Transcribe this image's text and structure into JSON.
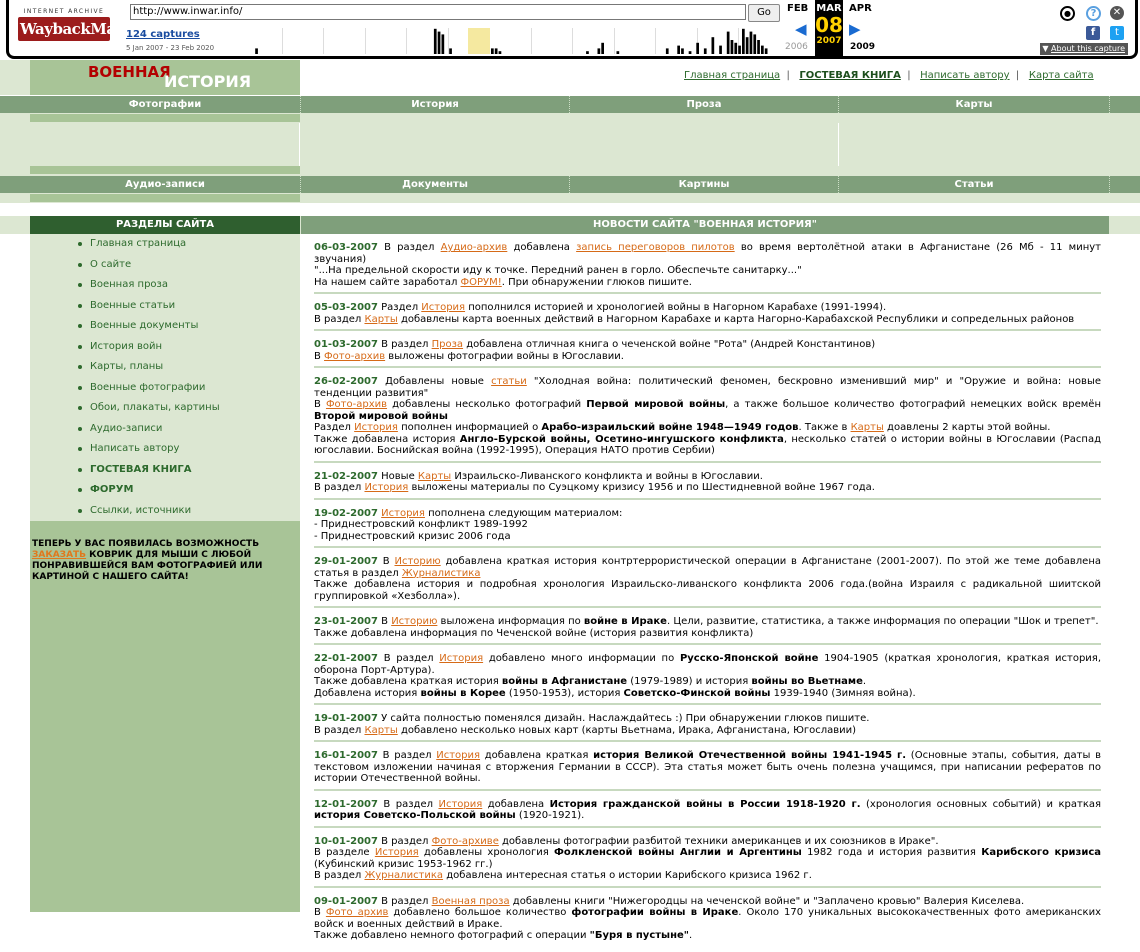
{
  "wayback": {
    "logo_top": "INTERNET ARCHIVE",
    "logo_main": "WaybackMachine",
    "url": "http://www.inwar.info/",
    "go_label": "Go",
    "captures": "124 captures",
    "date_range": "5 Jan 2007 - 23 Feb 2020",
    "month_prev": "FEB",
    "month_cur": "MAR",
    "month_next": "APR",
    "day": "08",
    "year_prev": "2006",
    "year_cur": "2007",
    "year_next": "2009",
    "about": "About this capture",
    "sparkline_values": [
      0,
      0,
      0,
      0,
      2,
      0,
      0,
      0,
      0,
      0,
      0,
      0,
      0,
      0,
      0,
      0,
      0,
      0,
      0,
      0,
      0,
      0,
      0,
      0,
      0,
      0,
      0,
      0,
      0,
      0,
      0,
      0,
      0,
      0,
      0,
      0,
      0,
      0,
      0,
      0,
      0,
      0,
      0,
      0,
      0,
      0,
      0,
      0,
      0,
      0,
      0,
      9,
      8,
      7,
      0,
      2,
      0,
      0,
      0,
      0,
      0,
      0,
      0,
      0,
      0,
      0,
      2,
      2,
      1,
      0,
      0,
      0,
      0,
      0,
      0,
      0,
      0,
      0,
      0,
      0,
      0,
      0,
      0,
      0,
      0,
      0,
      0,
      0,
      0,
      0,
      0,
      1,
      0,
      0,
      2,
      4,
      0,
      0,
      0,
      1,
      0,
      0,
      0,
      0,
      0,
      0,
      0,
      0,
      0,
      0,
      0,
      0,
      2,
      0,
      0,
      3,
      2,
      0,
      1,
      0,
      4,
      0,
      2,
      0,
      6,
      0,
      3,
      0,
      8,
      5,
      4,
      3,
      9,
      6,
      8,
      7,
      5,
      3,
      2,
      0,
      0,
      0
    ]
  },
  "site": {
    "logo_word1": "ВОЕННАЯ",
    "logo_word2": "ИСТОРИЯ",
    "toplinks": [
      "Главная страница",
      "ГОСТЕВАЯ КНИГА",
      "Написать автору",
      "Карта сайта"
    ],
    "menu1": [
      "Фотографии",
      "История",
      "Проза",
      "Карты"
    ],
    "menu2": [
      "Аудио-записи",
      "Документы",
      "Картины",
      "Статьи"
    ],
    "sidebar_title": "РАЗДЕЛЫ САЙТА",
    "news_title": "НОВОСТИ САЙТА \"ВОЕННАЯ ИСТОРИЯ\"",
    "sidebar": [
      {
        "label": "Главная страница",
        "bold": false
      },
      {
        "label": "О сайте",
        "bold": false
      },
      {
        "label": "Военная проза",
        "bold": false
      },
      {
        "label": "Военные статьи",
        "bold": false
      },
      {
        "label": "Военные документы",
        "bold": false
      },
      {
        "label": "История войн",
        "bold": false
      },
      {
        "label": "Карты, планы",
        "bold": false
      },
      {
        "label": "Военные фотографии",
        "bold": false
      },
      {
        "label": "Обои, плакаты, картины",
        "bold": false
      },
      {
        "label": "Аудио-записи",
        "bold": false
      },
      {
        "label": "Написать автору",
        "bold": false
      },
      {
        "label": "ГОСТЕВАЯ КНИГА",
        "bold": true
      },
      {
        "label": "ФОРУМ",
        "bold": true
      },
      {
        "label": "Ссылки, источники",
        "bold": false
      }
    ],
    "promo": {
      "part1": "ТЕПЕРЬ У ВАС ПОЯВИЛАСЬ ВОЗМОЖНОСТЬ ",
      "link": "ЗАКАЗАТЬ",
      "part2": " КОВРИК ДЛЯ МЫШИ С ЛЮБОЙ ПОНРАВИВШЕЙСЯ ВАМ ФОТОГРАФИЕЙ ИЛИ КАРТИНОЙ С НАШЕГО САЙТА!"
    }
  },
  "news": [
    {
      "date": "06-03-2007",
      "lines": [
        [
          [
            "t",
            " В раздел "
          ],
          [
            "l",
            "Аудио-архив"
          ],
          [
            "t",
            " добавлена "
          ],
          [
            "l",
            "запись переговоров пилотов"
          ],
          [
            "t",
            " во время вертолётной атаки в Афганистане (26 Мб - 11 минут звучания)"
          ]
        ],
        [
          [
            "t",
            "\"...На предельной скорости иду к точке. Передний ранен в горло. Обеспечьте санитарку...\""
          ]
        ],
        [
          [
            "t",
            "На нашем сайте заработал "
          ],
          [
            "l",
            "ФОРУМ!"
          ],
          [
            "t",
            ". При обнаружении глюков пишите."
          ]
        ]
      ]
    },
    {
      "date": "05-03-2007",
      "lines": [
        [
          [
            "t",
            " Раздел "
          ],
          [
            "l",
            "История"
          ],
          [
            "t",
            " пополнился историей и хронологией войны в Нагорном Карабахе (1991-1994)."
          ]
        ],
        [
          [
            "t",
            "В раздел "
          ],
          [
            "l",
            "Карты"
          ],
          [
            "t",
            " добавлены карта военных действий в Нагорном Карабахе и карта Нагорно-Карабахской Республики и сопредельных районов"
          ]
        ]
      ]
    },
    {
      "date": "01-03-2007",
      "lines": [
        [
          [
            "t",
            " В раздел "
          ],
          [
            "l",
            "Проза"
          ],
          [
            "t",
            " добавлена отличная книга о чеченской войне \"Рота\" (Андрей Константинов)"
          ]
        ],
        [
          [
            "t",
            "В "
          ],
          [
            "l",
            "Фото-архив"
          ],
          [
            "t",
            " выложены фотографии войны в Югославии."
          ]
        ]
      ]
    },
    {
      "date": "26-02-2007",
      "lines": [
        [
          [
            "t",
            " Добавлены новые "
          ],
          [
            "l",
            "статьи"
          ],
          [
            "t",
            " \"Холодная война: политический феномен, бескровно изменивший мир\" и \"Оружие и война: новые тенденции развития\""
          ]
        ],
        [
          [
            "t",
            "В "
          ],
          [
            "l",
            "Фото-архив"
          ],
          [
            "t",
            " добавлены несколько фотографий "
          ],
          [
            "b",
            "Первой мировой войны"
          ],
          [
            "t",
            ", а также большое количество фотографий немецких войск времён "
          ],
          [
            "b",
            "Второй мировой войны"
          ]
        ],
        [
          [
            "t",
            "Раздел "
          ],
          [
            "l",
            "История"
          ],
          [
            "t",
            " пополнен информацией о "
          ],
          [
            "b",
            "Арабо-израильский войне 1948—1949 годов"
          ],
          [
            "t",
            ". Также в "
          ],
          [
            "l",
            "Карты"
          ],
          [
            "t",
            " доавлены 2 карты этой войны."
          ]
        ],
        [
          [
            "t",
            "Также добавлена история "
          ],
          [
            "b",
            "Англо-Бурской войны, Осетино-ингушского конфликта"
          ],
          [
            "t",
            ", несколько статей о истории войны в Югославии (Распад югославии. Боснийская война (1992-1995), Операция НАТО против Сербии)"
          ]
        ]
      ]
    },
    {
      "date": "21-02-2007",
      "lines": [
        [
          [
            "t",
            " Новые "
          ],
          [
            "l",
            "Карты"
          ],
          [
            "t",
            " Израильско-Ливанского конфликта и войны в Югославии."
          ]
        ],
        [
          [
            "t",
            "В раздел "
          ],
          [
            "l",
            "История"
          ],
          [
            "t",
            " выложены материалы по Суэцкому кризису 1956 и по Шестидневной войне 1967 года."
          ]
        ]
      ]
    },
    {
      "date": "19-02-2007",
      "lines": [
        [
          [
            "t",
            " "
          ],
          [
            "l",
            "История"
          ],
          [
            "t",
            " пополнена следующим материалом:"
          ]
        ],
        [
          [
            "t",
            "- Приднестровский конфликт 1989-1992"
          ]
        ],
        [
          [
            "t",
            "- Приднестровский кризис 2006 года"
          ]
        ]
      ]
    },
    {
      "date": "29-01-2007",
      "lines": [
        [
          [
            "t",
            " В "
          ],
          [
            "l",
            "Историю"
          ],
          [
            "t",
            " добавлена краткая история контртеррористической операции в Афганистане (2001-2007). По этой же теме добавлена статья в раздел "
          ],
          [
            "l",
            "Журналистика"
          ]
        ],
        [
          [
            "t",
            "Также добавлена история и подробная хронология Израильско-ливанского конфликта 2006 года.(война Израиля с радикальной шиитской группировкой «Хезболла»)."
          ]
        ]
      ]
    },
    {
      "date": "23-01-2007",
      "lines": [
        [
          [
            "t",
            " В "
          ],
          [
            "l",
            "Историю"
          ],
          [
            "t",
            " выложена информация по "
          ],
          [
            "b",
            "войне в Ираке"
          ],
          [
            "t",
            ". Цели, развитие, статистика, а также информация по операции \"Шок и трепет\"."
          ]
        ],
        [
          [
            "t",
            "Также добавлена информация по Чеченской войне (история развития конфликта)"
          ]
        ]
      ]
    },
    {
      "date": "22-01-2007",
      "lines": [
        [
          [
            "t",
            " В раздел "
          ],
          [
            "l",
            "История"
          ],
          [
            "t",
            " добавлено много информации по "
          ],
          [
            "b",
            "Русско-Японской войне"
          ],
          [
            "t",
            " 1904-1905 (краткая хронология, краткая история, оборона Порт-Артура)."
          ]
        ],
        [
          [
            "t",
            "Также добавлена краткая история "
          ],
          [
            "b",
            "войны в Афганистане"
          ],
          [
            "t",
            " (1979-1989) и история "
          ],
          [
            "b",
            "войны во Вьетнаме"
          ],
          [
            "t",
            "."
          ]
        ],
        [
          [
            "t",
            "Добавлена история "
          ],
          [
            "b",
            "войны в Корее"
          ],
          [
            "t",
            " (1950-1953), история "
          ],
          [
            "b",
            "Советско-Финской войны"
          ],
          [
            "t",
            " 1939-1940 (Зимняя война)."
          ]
        ]
      ]
    },
    {
      "date": "19-01-2007",
      "lines": [
        [
          [
            "t",
            " У сайта полностью поменялся дизайн. Наслаждайтесь :) При обнаружении глюков пишите."
          ]
        ],
        [
          [
            "t",
            "В раздел "
          ],
          [
            "l",
            "Карты"
          ],
          [
            "t",
            " добавлено несколько новых карт (карты Вьетнама, Ирака, Афганистана, Югославии)"
          ]
        ]
      ]
    },
    {
      "date": "16-01-2007",
      "lines": [
        [
          [
            "t",
            " В раздел "
          ],
          [
            "l",
            "История"
          ],
          [
            "t",
            " добавлена краткая "
          ],
          [
            "b",
            "история Великой Отечественной войны 1941-1945 г."
          ],
          [
            "t",
            " (Основные этапы, события, даты в текстовом изложении начиная с вторжения Германии в СССР). Эта статья может быть очень полезна учащимся, при написании рефератов по истории Отечественной войны."
          ]
        ]
      ]
    },
    {
      "date": "12-01-2007",
      "lines": [
        [
          [
            "t",
            " В раздел "
          ],
          [
            "l",
            "История"
          ],
          [
            "t",
            " добавлена "
          ],
          [
            "b",
            "История гражданской войны в России 1918-1920 г."
          ],
          [
            "t",
            " (хронология основных событий) и краткая "
          ],
          [
            "b",
            "история Советско-Польской войны"
          ],
          [
            "t",
            " (1920-1921)."
          ]
        ]
      ]
    },
    {
      "date": "10-01-2007",
      "lines": [
        [
          [
            "t",
            " В раздел "
          ],
          [
            "l",
            "Фото-архиве"
          ],
          [
            "t",
            " добавлены фотографии разбитой техники американцев и их союзников в Ираке\"."
          ]
        ],
        [
          [
            "t",
            "В разделе "
          ],
          [
            "l",
            "История"
          ],
          [
            "t",
            " добавлены хронология "
          ],
          [
            "b",
            "Фолкленской войны Англии и Аргентины"
          ],
          [
            "t",
            " 1982 года и история развития "
          ],
          [
            "b",
            "Карибского кризиса"
          ],
          [
            "t",
            " (Кубинский кризис 1953-1962 гг.)"
          ]
        ],
        [
          [
            "t",
            "В раздел "
          ],
          [
            "l",
            "Журналистика"
          ],
          [
            "t",
            " добавлена интересная статья о истории Карибского кризиса 1962 г."
          ]
        ]
      ]
    },
    {
      "date": "09-01-2007",
      "lines": [
        [
          [
            "t",
            " В раздел "
          ],
          [
            "l",
            "Военная проза"
          ],
          [
            "t",
            " добавлены книги \"Нижегородцы на чеченской войне\" и \"Заплачено кровью\" Валерия Киселева."
          ]
        ],
        [
          [
            "t",
            " "
          ]
        ],
        [
          [
            "t",
            "В "
          ],
          [
            "l",
            "Фото архив"
          ],
          [
            "t",
            " добавлено большое количество "
          ],
          [
            "b",
            "фотографии войны в Ираке"
          ],
          [
            "t",
            ". Около 170 уникальных высококачественных фото американских войск и военных действий в Ираке."
          ]
        ],
        [
          [
            "t",
            "Также добавлено немного фотографий с операции "
          ],
          [
            "b",
            "\"Буря в пустыне\""
          ],
          [
            "t",
            "."
          ]
        ]
      ]
    }
  ]
}
